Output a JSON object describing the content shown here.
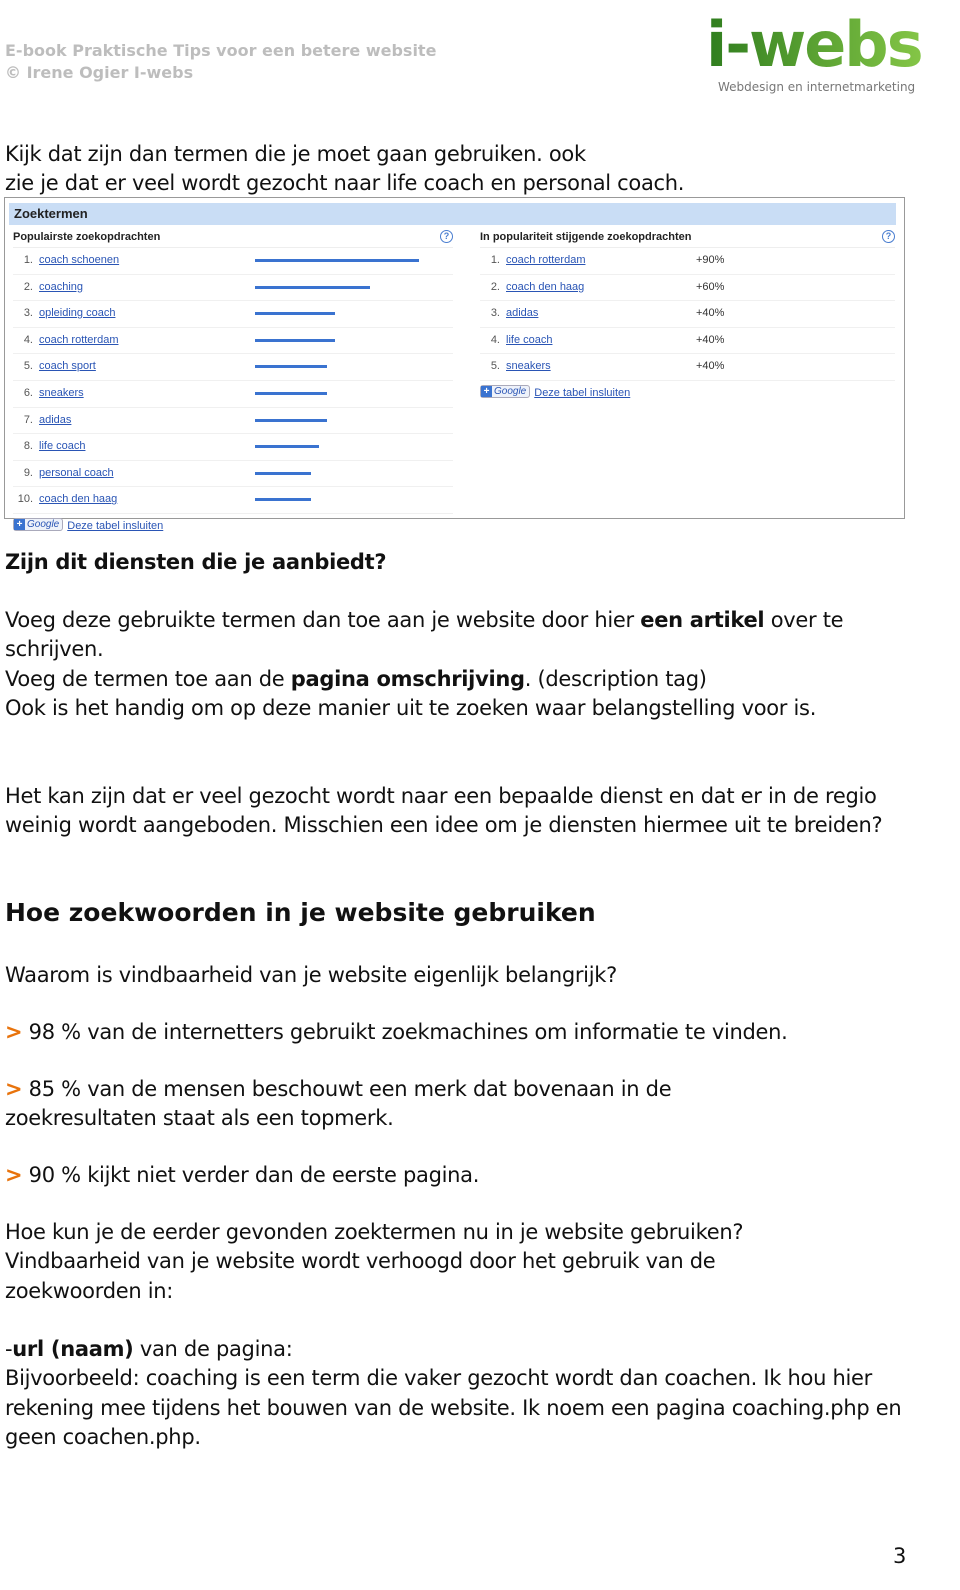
{
  "header": {
    "line1": "E-book Praktische Tips voor een betere website",
    "line2": "© Irene Ogier I-webs"
  },
  "logo": {
    "word": "i-webs",
    "tagline": "Webdesign en internetmarketing",
    "color": "#5aa83a"
  },
  "intro": {
    "line1": "Kijk dat zijn dan termen die je moet gaan gebruiken. ook",
    "line2": "zie je dat er veel wordt gezocht naar life coach en personal coach."
  },
  "screenshot": {
    "title": "Zoektermen",
    "popular": {
      "heading": "Populairste zoekopdrachten",
      "help": "?",
      "items": [
        {
          "n": "1.",
          "term": "coach schoenen",
          "level": 100
        },
        {
          "n": "2.",
          "term": "coaching",
          "level": 70
        },
        {
          "n": "3.",
          "term": "opleiding coach",
          "level": 49
        },
        {
          "n": "4.",
          "term": "coach rotterdam",
          "level": 49
        },
        {
          "n": "5.",
          "term": "coach sport",
          "level": 44
        },
        {
          "n": "6.",
          "term": "sneakers",
          "level": 44
        },
        {
          "n": "7.",
          "term": "adidas",
          "level": 44
        },
        {
          "n": "8.",
          "term": "life coach",
          "level": 39
        },
        {
          "n": "9.",
          "term": "personal coach",
          "level": 34
        },
        {
          "n": "10.",
          "term": "coach den haag",
          "level": 34
        }
      ],
      "google": "Google",
      "embed": "Deze tabel insluiten"
    },
    "rising": {
      "heading": "In populariteit stijgende zoekopdrachten",
      "help": "?",
      "items": [
        {
          "n": "1.",
          "term": "coach rotterdam",
          "pct": "+90%"
        },
        {
          "n": "2.",
          "term": "coach den haag",
          "pct": "+60%"
        },
        {
          "n": "3.",
          "term": "adidas",
          "pct": "+40%"
        },
        {
          "n": "4.",
          "term": "life coach",
          "pct": "+40%"
        },
        {
          "n": "5.",
          "term": "sneakers",
          "pct": "+40%"
        }
      ],
      "google": "Google",
      "embed": "Deze tabel insluiten"
    },
    "bar_color": "#3a73d0"
  },
  "body": {
    "question": "Zijn dit diensten die je aanbiedt?",
    "p1a": "Voeg deze gebruikte termen dan toe aan je website door hier ",
    "p1b": "een artikel",
    "p1c": " over te schrijven.",
    "p2a": "Voeg de termen toe aan de ",
    "p2b": "pagina omschrijving",
    "p2c": ". (description tag)",
    "p3": "Ook is het handig om op deze manier uit te zoeken waar belangstelling voor is.",
    "p4": "Het kan zijn dat er veel gezocht wordt naar een bepaalde dienst en dat er in de regio weinig wordt aangeboden. Misschien een idee om je diensten hiermee uit te breiden?",
    "heading": "Hoe zoekwoorden in je website gebruiken",
    "p5": "Waarom is vindbaarheid van je website eigenlijk belangrijk?",
    "arrow": ">",
    "b1": " 98 % van de internetters gebruikt zoekmachines om informatie te vinden.",
    "b2": " 85 % van de mensen beschouwt een merk dat bovenaan in de zoekresultaten staat als een topmerk.",
    "b3": " 90 % kijkt niet verder dan de eerste pagina.",
    "p6": "Hoe kun je de eerder gevonden zoektermen nu in je website gebruiken? Vindbaarheid van je website wordt verhoogd door het gebruik van de zoekwoorden in:",
    "p7a": "-",
    "p7b": "url (naam)",
    "p7c": " van de pagina:",
    "p8": "Bijvoorbeeld: coaching is een term die vaker gezocht wordt dan coachen. Ik hou hier rekening mee tijdens het bouwen van de website. Ik noem een pagina coaching.php en geen coachen.php.",
    "arrow_color": "#e8730c"
  },
  "page_number": "3"
}
